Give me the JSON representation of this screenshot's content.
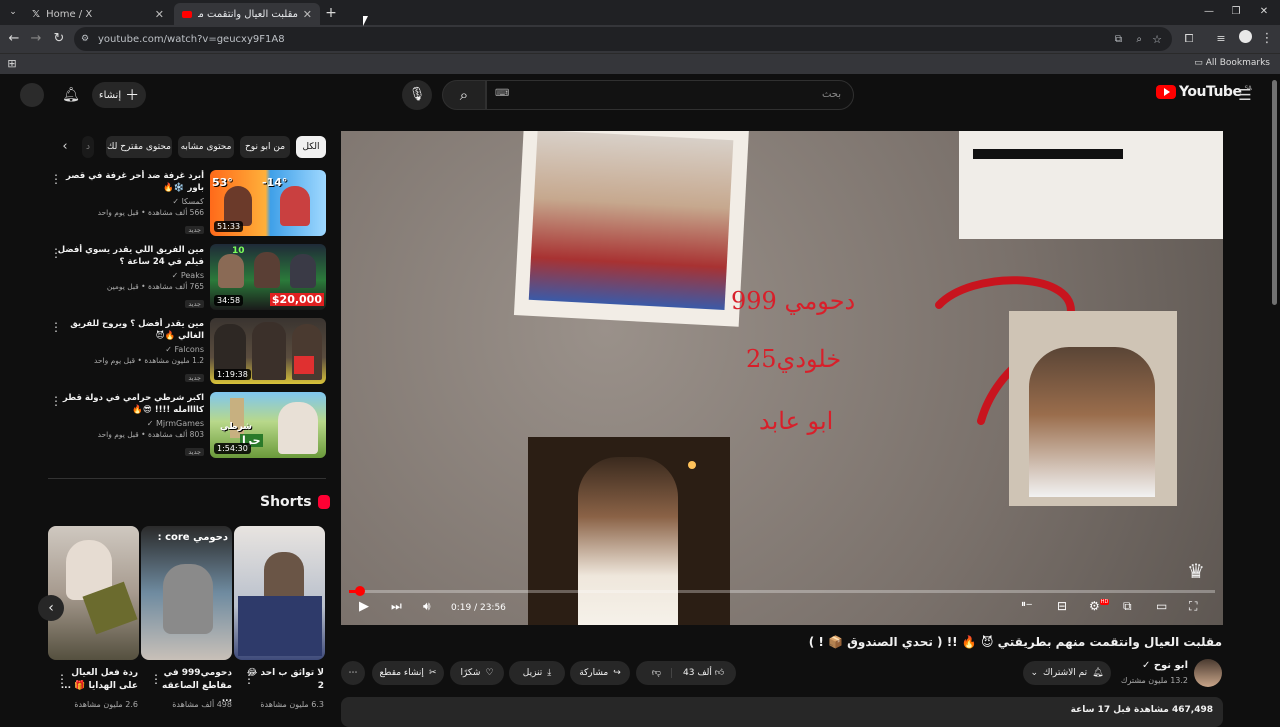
{
  "browser": {
    "tabs": [
      {
        "title": "Home / X",
        "icon": "x-logo-icon"
      },
      {
        "title": "مقلبت العيال وانتقمت منهم بطر",
        "icon": "youtube-icon"
      }
    ],
    "new_tab": "+",
    "url": "youtube.com/watch?v=geucxy9F1A8",
    "bookmarks_label": "All Bookmarks",
    "window_controls": [
      "—",
      "❐",
      "✕"
    ]
  },
  "yt_header": {
    "logo_text": "YouTube",
    "region": "SA",
    "search_placeholder": "بحث",
    "create_label": "إنشاء"
  },
  "chips": [
    "الكل",
    "من ابو نوح",
    "محتوى مشابه",
    "محتوى مقترح لك",
    "د"
  ],
  "sidebar_videos": [
    {
      "title": "أبرد غرفة ضد أحر غرفة في قصر باور ❄️🔥",
      "channel": "كمسكا",
      "meta": "566 ألف مشاهدة • قبل يوم واحد",
      "badge": "جديد",
      "duration": "51:33",
      "thumb_text": [
        "53°",
        "-14°"
      ]
    },
    {
      "title": "مين الفريق اللي يقدر يسوي أفضل فيلم في 24 ساعة ؟",
      "channel": "Peaks",
      "meta": "765 ألف مشاهدة • قبل يومين",
      "badge": "جديد",
      "duration": "34:58",
      "thumb_text": [
        "$20,000",
        "10"
      ]
    },
    {
      "title": "مين يقدر أفضل ؟ ويروح للفريق الغالي 🔥😈",
      "channel": "Falcons",
      "meta": "1.2 مليون مشاهدة • قبل يوم واحد",
      "badge": "جديد",
      "duration": "1:19:38",
      "thumb_text": []
    },
    {
      "title": "اكبر شرطي حرامي في دولة قطر كاااامله !!!! 😎🔥",
      "channel": "MjrmGames",
      "meta": "803 ألف مشاهدة • قبل يوم واحد",
      "badge": "جديد",
      "duration": "1:54:30",
      "thumb_text": [
        "شرطي",
        "حرا"
      ]
    }
  ],
  "shorts": {
    "heading": "Shorts",
    "items": [
      {
        "title": "ردة فعل العيال على الهدايا 🎁 ...",
        "views": "2.6 مليون مشاهدة",
        "overlay": ""
      },
      {
        "title": "دحومي999 في مقاطع الصاعقه ...",
        "views": "498 ألف مشاهدة",
        "overlay": "دحومي core :"
      },
      {
        "title": "لا تواثق ب احد 😂 2",
        "views": "6.3 مليون مشاهدة",
        "overlay": ""
      }
    ]
  },
  "player": {
    "overlay_texts": [
      "دحومي 999",
      "خلودي25",
      "ابو عابد"
    ],
    "time": "0:19 / 23:56",
    "progress": 0.013,
    "hd_badge": "HD"
  },
  "video": {
    "title": "مقلبت العيال وانتقمت منهم بطريقتي 😈 🔥 !! ( تحدي الصندوق 📦 ! )",
    "channel": "ابو نوح",
    "subscribers": "13.2 مليون مشترك",
    "subscribed_label": "تم الاشتراك",
    "likes": "43 ألف",
    "share_label": "مشاركة",
    "download_label": "تنزيل",
    "thanks_label": "شكرًا",
    "clip_label": "إنشاء مقطع",
    "views_line": "467,498 مشاهدة  قبل 17 ساعة"
  }
}
